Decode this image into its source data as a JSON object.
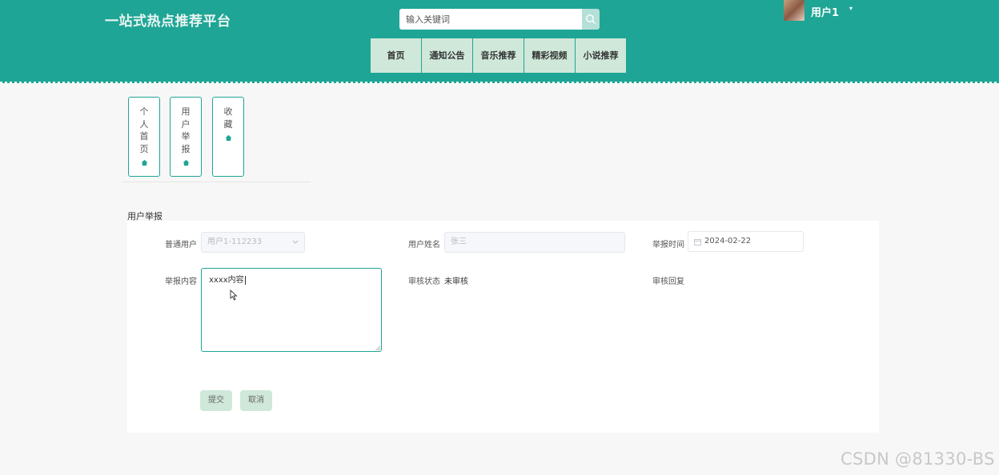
{
  "header": {
    "site_title": "一站式热点推荐平台",
    "search_placeholder": "输入关键词",
    "user_name": "用户1",
    "user_caret": "▾"
  },
  "nav": {
    "items": [
      {
        "label": "首页"
      },
      {
        "label": "通知公告"
      },
      {
        "label": "音乐推荐"
      },
      {
        "label": "精彩视频"
      },
      {
        "label": "小说推荐"
      }
    ]
  },
  "side_tabs": [
    {
      "label": "个人首页"
    },
    {
      "label": "用户举报"
    },
    {
      "label": "收藏"
    }
  ],
  "form": {
    "section_title": "用户举报",
    "user_label": "普通用户",
    "user_value": "用户1-112233",
    "name_label": "用户姓名",
    "name_value": "张三",
    "time_label": "举报时间",
    "time_value": "2024-02-22",
    "content_label": "举报内容",
    "content_value": "xxxx内容",
    "status_label": "审核状态",
    "status_value": "未审核",
    "reply_label": "审核回复",
    "submit_label": "提交",
    "cancel_label": "取消"
  },
  "watermark": "CSDN @81330-BS",
  "colors": {
    "primary": "#1fa595",
    "nav_button": "#cfe8d9",
    "background": "#f7f7f7"
  }
}
